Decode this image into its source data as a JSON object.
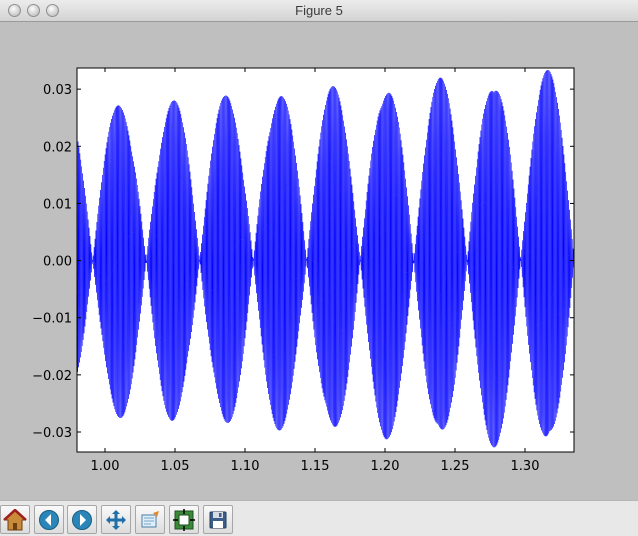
{
  "window": {
    "title": "Figure 5"
  },
  "chart_data": {
    "type": "line",
    "title": "",
    "xlabel": "",
    "ylabel": "",
    "xlim": [
      0.98,
      1.335
    ],
    "ylim": [
      -0.0335,
      0.0337
    ],
    "xticks": [
      "1.00",
      "1.05",
      "1.10",
      "1.15",
      "1.20",
      "1.25",
      "1.30"
    ],
    "xtick_values": [
      1.0,
      1.05,
      1.1,
      1.15,
      1.2,
      1.25,
      1.3
    ],
    "yticks": [
      "0.03",
      "0.02",
      "0.01",
      "0.00",
      "−0.01",
      "−0.02",
      "−0.03"
    ],
    "ytick_values": [
      0.03,
      0.02,
      0.01,
      0.0,
      -0.01,
      -0.02,
      -0.03
    ],
    "series": [
      {
        "color": "#0000ff",
        "envelope_x": [
          0.98,
          1.335
        ],
        "envelope_upper": [
          0.0275,
          0.0337
        ],
        "envelope_lower": [
          -0.0275,
          -0.0337
        ]
      }
    ],
    "grid": false
  },
  "toolbar": {
    "buttons": [
      {
        "name": "home-button",
        "icon": "home-icon"
      },
      {
        "name": "back-button",
        "icon": "back-arrow-icon"
      },
      {
        "name": "forward-button",
        "icon": "forward-arrow-icon"
      },
      {
        "name": "pan-button",
        "icon": "move-icon"
      },
      {
        "name": "zoom-button",
        "icon": "zoom-rect-icon"
      },
      {
        "name": "subplots-button",
        "icon": "subplots-icon"
      },
      {
        "name": "save-button",
        "icon": "floppy-icon"
      }
    ]
  }
}
